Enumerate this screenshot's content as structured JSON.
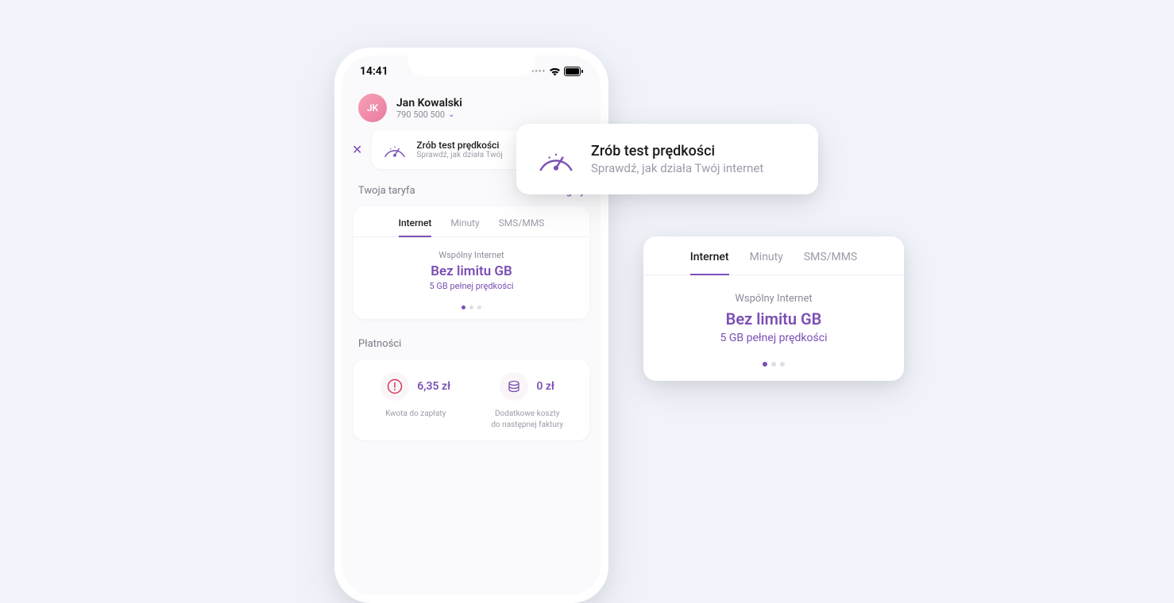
{
  "status": {
    "time": "14:41"
  },
  "profile": {
    "initials": "JK",
    "name": "Jan Kowalski",
    "phone": "790 500 500"
  },
  "banner": {
    "title": "Zrób test prędkości",
    "sub": "Sprawdź, jak działa Twój"
  },
  "tariff": {
    "section": "Twoja taryfa",
    "details": "Szczegóły",
    "tabs": {
      "internet": "Internet",
      "minutes": "Minuty",
      "sms": "SMS/MMS"
    },
    "label": "Wspólny Internet",
    "main": "Bez limitu GB",
    "sub": "5 GB pełnej prędkości"
  },
  "payments": {
    "section": "Płatności",
    "left": {
      "amount": "6,35 zł",
      "label": "Kwota do zapłaty"
    },
    "right": {
      "amount": "0 zł",
      "label1": "Dodatkowe koszty",
      "label2": "do następnej faktury"
    }
  },
  "callout_speed": {
    "title": "Zrób test prędkości",
    "sub": "Sprawdź, jak działa Twój internet"
  }
}
